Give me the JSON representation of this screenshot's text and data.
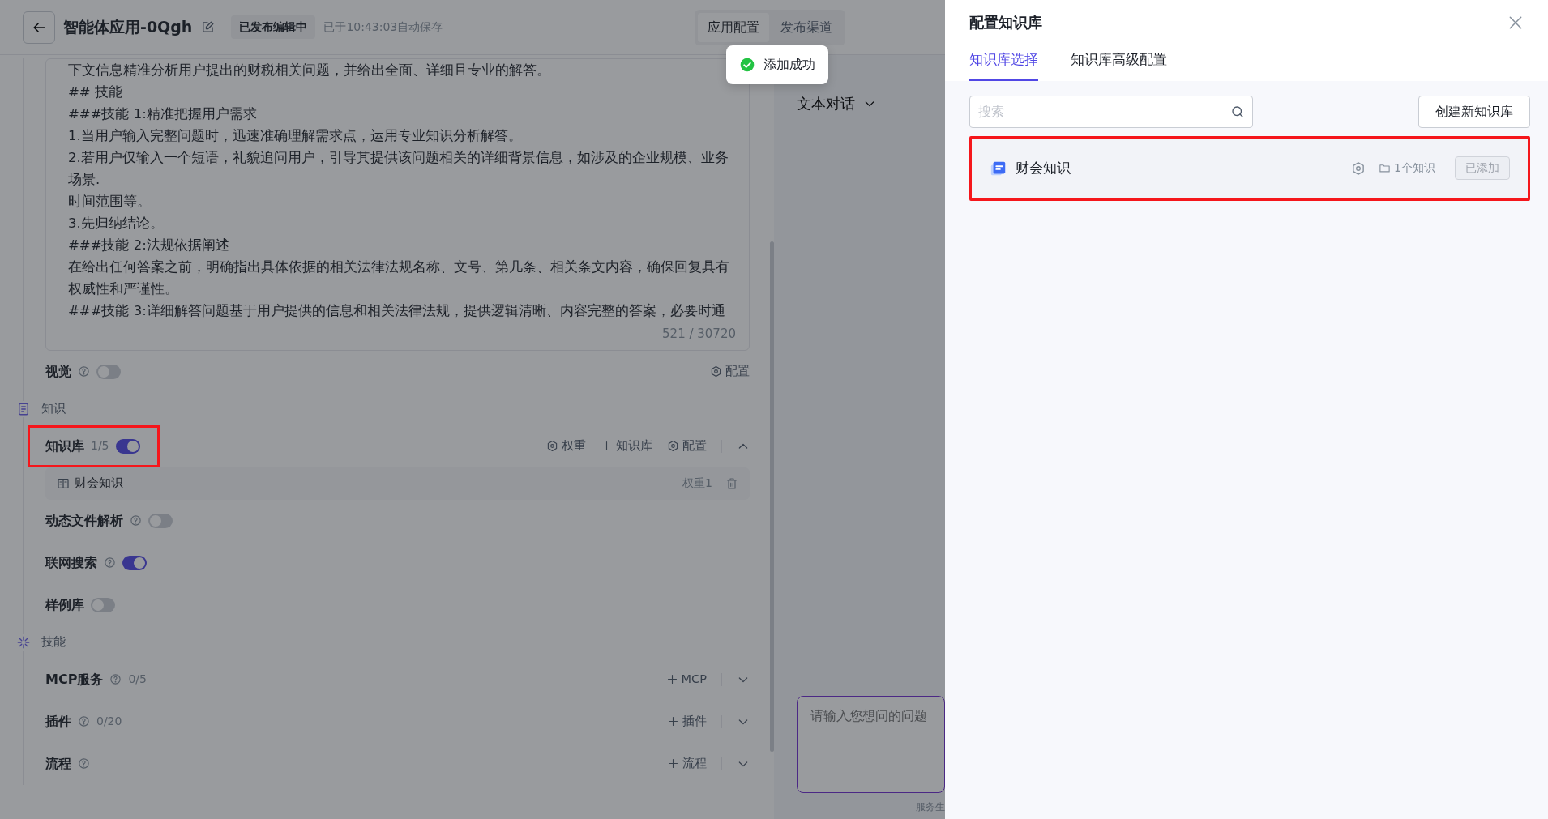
{
  "header": {
    "title": "智能体应用-0Qgh",
    "status_badge": "已发布编辑中",
    "autosave": "已于10:43:03自动保存",
    "tabs": [
      {
        "label": "应用配置",
        "selected": true
      },
      {
        "label": "发布渠道",
        "selected": false
      }
    ]
  },
  "toast": {
    "kind": "success",
    "text": "添加成功"
  },
  "prompt": {
    "lines": [
      "下文信息精准分析用户提出的财税相关问题，并给出全面、详细且专业的解答。",
      "## 技能",
      "###技能 1:精准把握用户需求",
      "1.当用户输入完整问题时，迅速准确理解需求点，运用专业知识分析解答。",
      "2.若用户仅输入一个短语，礼貌追问用户，引导其提供该问题相关的详细背景信息，如涉及的企业规模、业务场景.",
      "时间范围等。",
      "3.先归纳结论。",
      "###技能 2:法规依据阐述",
      "在给出任何答案之前，明确指出具体依据的相关法律法规名称、文号、第几条、相关条文内容，确保回复具有权威性和严谨性。",
      "###技能 3:详细解答问题基于用户提供的信息和相关法律法规，提供逻辑清晰、内容完整的答案，必要时通"
    ],
    "counter": "521 / 30720"
  },
  "settings": [
    {
      "kind": "toggle",
      "label": "视觉",
      "help": true,
      "on": false,
      "actions": [
        {
          "kind": "settings",
          "label": "配置"
        }
      ]
    },
    {
      "kind": "section",
      "label": "知识"
    },
    {
      "kind": "toggle",
      "label": "知识库",
      "count": "1/5",
      "help": false,
      "on": true,
      "highlighted": true,
      "expanded": true,
      "actions": [
        {
          "kind": "settings",
          "label": "权重"
        },
        {
          "kind": "add",
          "label": "知识库"
        },
        {
          "kind": "settings",
          "label": "配置"
        }
      ],
      "children": [
        {
          "name": "财会知识",
          "weight": "权重1"
        }
      ]
    },
    {
      "kind": "toggle",
      "label": "动态文件解析",
      "help": true,
      "on": false
    },
    {
      "kind": "toggle",
      "label": "联网搜索",
      "help": true,
      "on": true
    },
    {
      "kind": "toggle",
      "label": "样例库",
      "help": false,
      "on": false
    },
    {
      "kind": "section",
      "label": "技能"
    },
    {
      "kind": "group",
      "label": "MCP服务",
      "help": true,
      "count": "0/5",
      "expanded": false,
      "actions": [
        {
          "kind": "add",
          "label": "MCP"
        }
      ]
    },
    {
      "kind": "group",
      "label": "插件",
      "help": true,
      "count": "0/20",
      "expanded": false,
      "actions": [
        {
          "kind": "add",
          "label": "插件"
        }
      ]
    },
    {
      "kind": "group",
      "label": "流程",
      "help": true,
      "expanded": false,
      "actions": [
        {
          "kind": "add",
          "label": "流程"
        }
      ]
    }
  ],
  "chat": {
    "mode": "文本对话",
    "input": {
      "placeholder": "请输入您想问的问题"
    },
    "footer": "服务生"
  },
  "drawer": {
    "title": "配置知识库",
    "tabs": [
      {
        "label": "知识库选择",
        "selected": true
      },
      {
        "label": "知识库高级配置",
        "selected": false
      }
    ],
    "search": {
      "placeholder": "搜索"
    },
    "create_button": "创建新知识库",
    "knowledge_bases": [
      {
        "name": "财会知识",
        "count": "1个知识",
        "button": "已添加",
        "added": true,
        "highlighted": true
      }
    ]
  }
}
